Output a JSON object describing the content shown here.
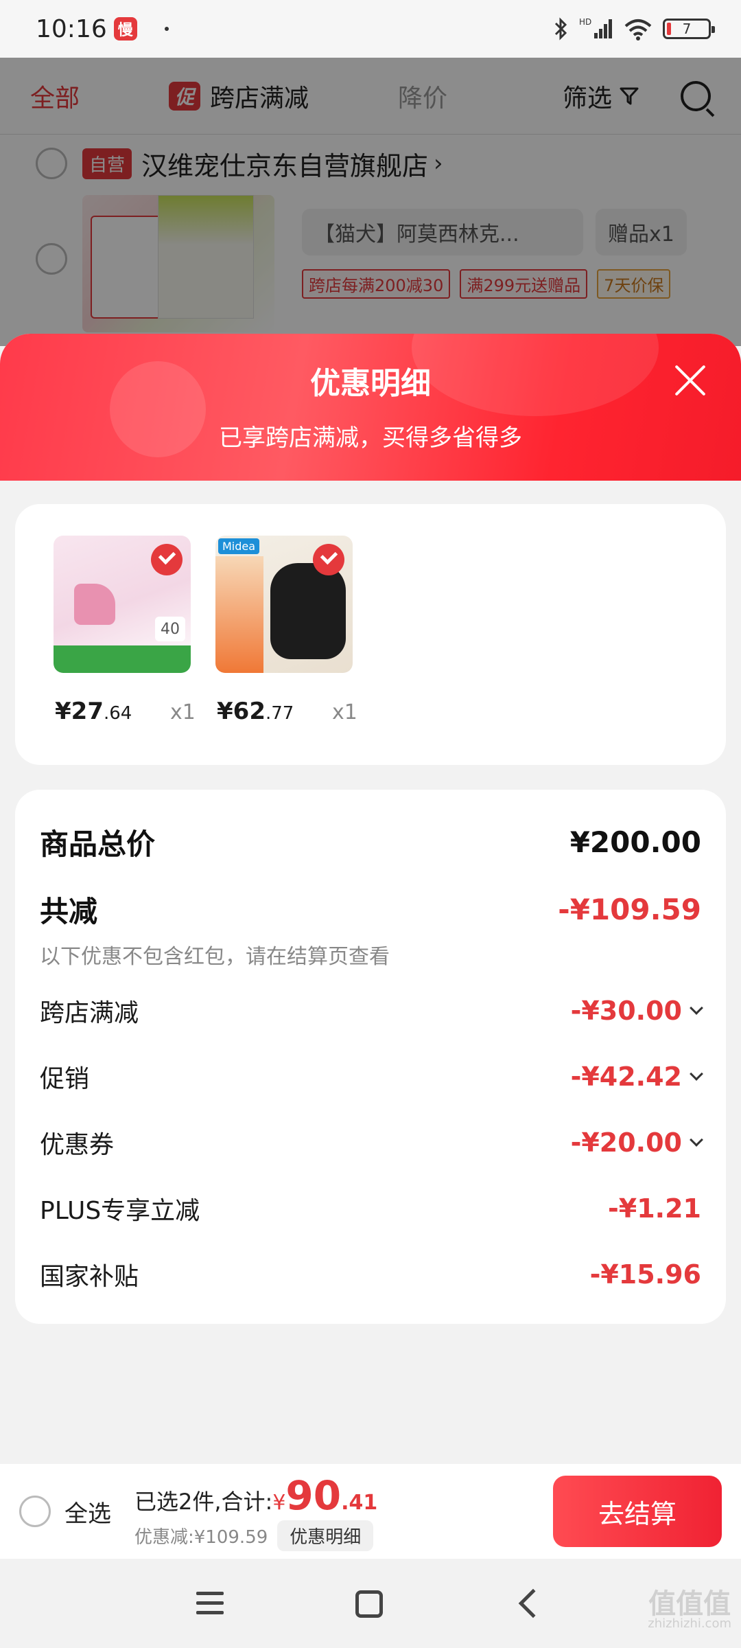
{
  "status_bar": {
    "time": "10:16",
    "app_badge": "慢",
    "battery": "7",
    "icons": [
      "bluetooth-icon",
      "signal-hd-icon",
      "wifi-icon",
      "battery-icon"
    ]
  },
  "cart_filter": {
    "all": "全部",
    "promo_badge": "促",
    "cross_store": "跨店满减",
    "price_drop": "降价",
    "filter": "筛选"
  },
  "store": {
    "badge": "自营",
    "name": "汉维宠仕京东自营旗舰店",
    "arrow": "›"
  },
  "product": {
    "sku": "【猫犬】阿莫西林克...",
    "gift": "赠品x1",
    "tags": [
      "跨店每满200减30",
      "满299元送赠品",
      "7天价保"
    ]
  },
  "sheet": {
    "title": "优惠明细",
    "subtitle": "已享跨店满减，买得多省得多"
  },
  "items": [
    {
      "price_int": "¥27",
      "price_dec": ".64",
      "qty": "x1",
      "badge": "40"
    },
    {
      "price_int": "¥62",
      "price_dec": ".77",
      "qty": "x1",
      "brand": "Midea"
    }
  ],
  "summary": {
    "total_label": "商品总价",
    "total_value": "¥200.00",
    "reduce_label": "共减",
    "reduce_value": "-¥109.59",
    "note": "以下优惠不包含红包，请在结算页查看",
    "lines": [
      {
        "label": "跨店满减",
        "value": "-¥30.00"
      },
      {
        "label": "促销",
        "value": "-¥42.42"
      },
      {
        "label": "优惠券",
        "value": "-¥20.00"
      },
      {
        "label": "PLUS专享立减",
        "value": "-¥1.21"
      },
      {
        "label": "国家补贴",
        "value": "-¥15.96"
      }
    ]
  },
  "bottom_bar": {
    "select_all": "全选",
    "selected_text": "已选2件,合计:",
    "currency": "¥",
    "total_int": "90",
    "total_dec": ".41",
    "discount_text": "优惠减:¥109.59",
    "detail_chip": "优惠明细",
    "checkout": "去结算"
  },
  "watermark": {
    "main": "值值值",
    "sub": "zhizhizhi.com"
  },
  "colors": {
    "accent": "#e4393c",
    "header_gradient_start": "#ff3a4a",
    "header_gradient_end": "#f51c2a"
  }
}
